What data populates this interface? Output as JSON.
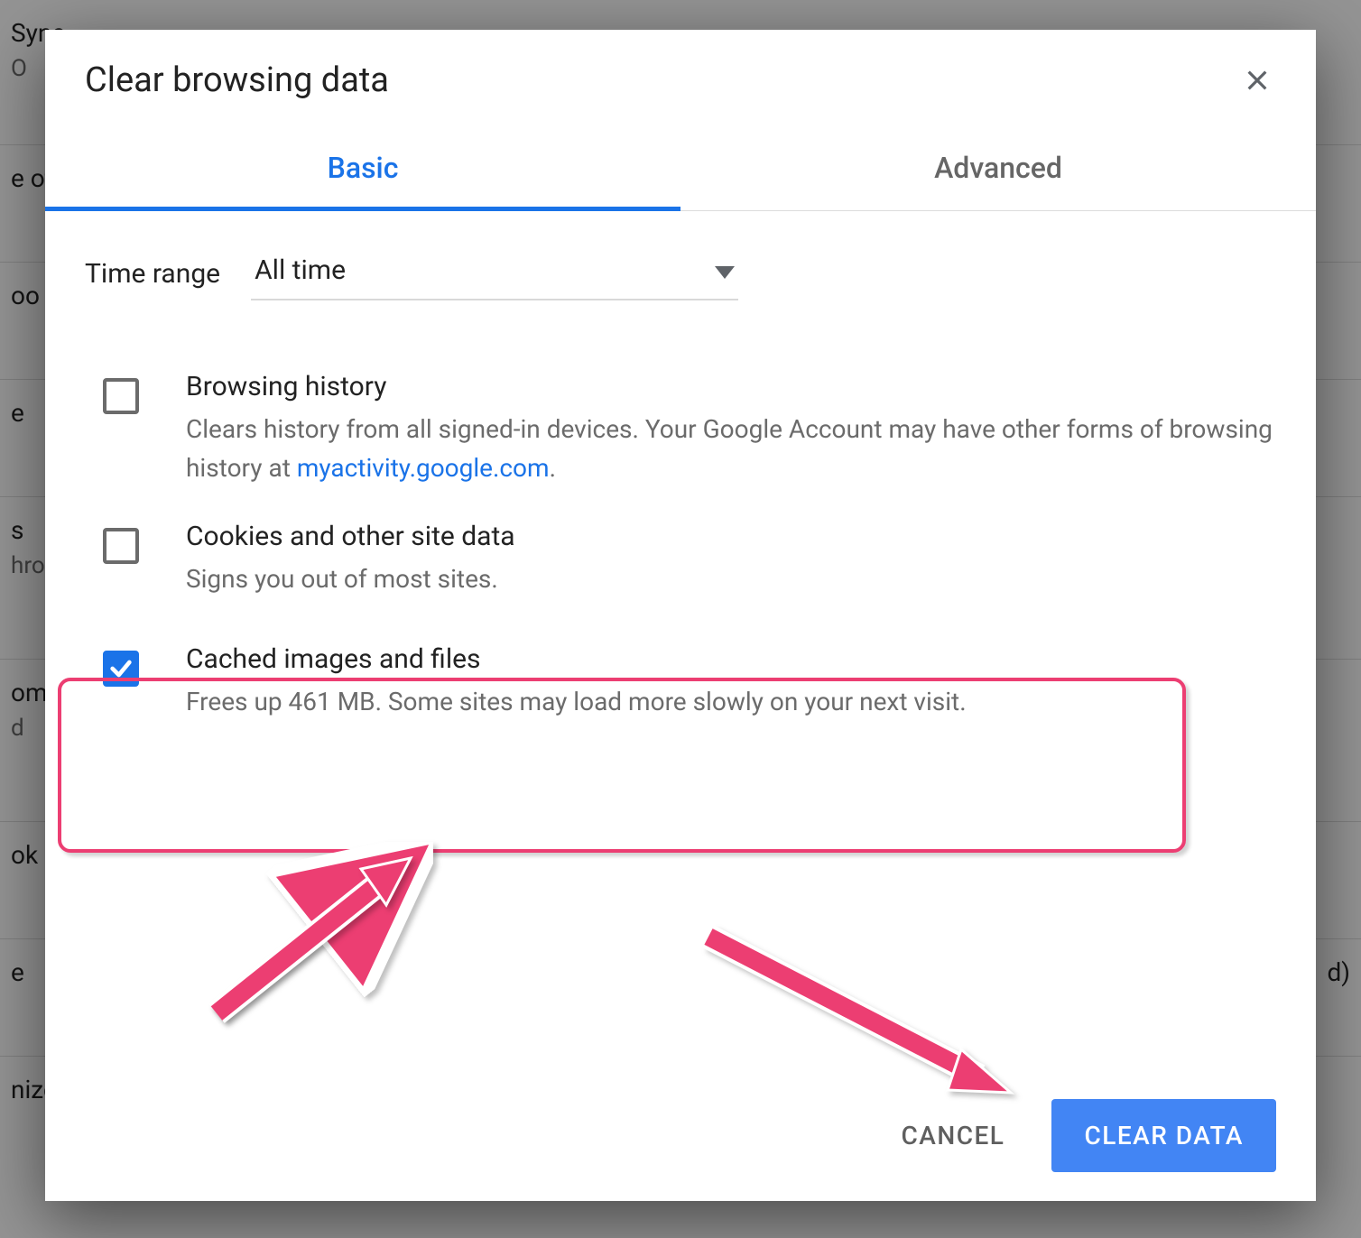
{
  "background": {
    "row1_title": "Sync",
    "row1_sub": "O",
    "row2": "e otl",
    "row3": "oo",
    "row4": "e",
    "row5_title": "s",
    "row5_sub": "hro",
    "row6_title": "ome",
    "row6_sub": "d",
    "row7": "ok",
    "row8": "e",
    "row8_right": "d)",
    "row9": "nize"
  },
  "dialog": {
    "title": "Clear browsing data",
    "tabs": {
      "basic": "Basic",
      "advanced": "Advanced"
    },
    "time_range": {
      "label": "Time range",
      "value": "All time"
    },
    "options": {
      "browsing_history": {
        "title": "Browsing history",
        "desc_pre": "Clears history from all signed-in devices. Your Google Account may have other forms of browsing history at ",
        "desc_link": "myactivity.google.com",
        "desc_post": ".",
        "checked": false
      },
      "cookies": {
        "title": "Cookies and other site data",
        "desc": "Signs you out of most sites.",
        "checked": false
      },
      "cached": {
        "title": "Cached images and files",
        "desc": "Frees up 461 MB. Some sites may load more slowly on your next visit.",
        "checked": true
      }
    },
    "buttons": {
      "cancel": "CANCEL",
      "clear": "CLEAR DATA"
    }
  }
}
